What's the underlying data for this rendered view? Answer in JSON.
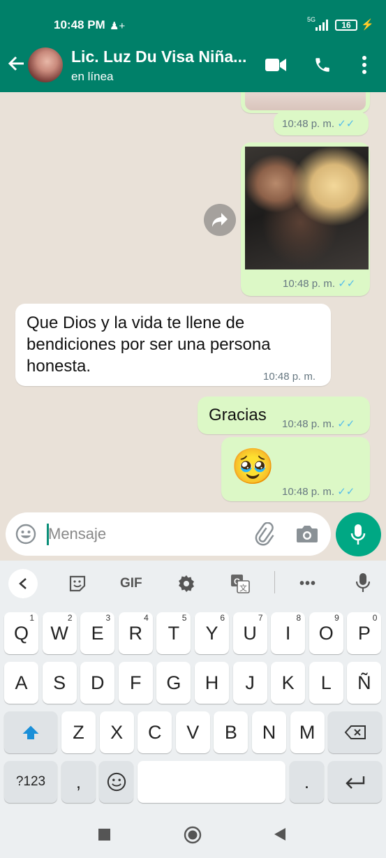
{
  "status_bar": {
    "time": "10:48 PM",
    "network": "5G",
    "battery": "16"
  },
  "header": {
    "contact_name": "Lic. Luz Du Visa Niña...",
    "status": "en línea"
  },
  "messages": [
    {
      "type": "image-partial",
      "direction": "out",
      "time": "10:48 p. m."
    },
    {
      "type": "image",
      "direction": "out",
      "time": "10:48 p. m."
    },
    {
      "type": "text",
      "direction": "in",
      "lines": [
        "Que Dios y la vida te llene de",
        "bendiciones por ser una persona",
        "honesta."
      ],
      "time": "10:48 p. m."
    },
    {
      "type": "text",
      "direction": "out",
      "text": "Gracias",
      "time": "10:48 p. m."
    },
    {
      "type": "emoji",
      "direction": "out",
      "emoji": "🥹",
      "time": "10:48 p. m."
    }
  ],
  "compose": {
    "placeholder": "Mensaje"
  },
  "keyboard": {
    "toolbar": {
      "gif": "GIF"
    },
    "row1": [
      {
        "k": "Q",
        "n": "1"
      },
      {
        "k": "W",
        "n": "2"
      },
      {
        "k": "E",
        "n": "3"
      },
      {
        "k": "R",
        "n": "4"
      },
      {
        "k": "T",
        "n": "5"
      },
      {
        "k": "Y",
        "n": "6"
      },
      {
        "k": "U",
        "n": "7"
      },
      {
        "k": "I",
        "n": "8"
      },
      {
        "k": "O",
        "n": "9"
      },
      {
        "k": "P",
        "n": "0"
      }
    ],
    "row2": [
      "A",
      "S",
      "D",
      "F",
      "G",
      "H",
      "J",
      "K",
      "L",
      "Ñ"
    ],
    "row3": [
      "Z",
      "X",
      "C",
      "V",
      "B",
      "N",
      "M"
    ],
    "symbols": "?123",
    "comma": ",",
    "period": "."
  },
  "colors": {
    "header": "#008069",
    "outgoing_bubble": "#dcf8c6",
    "incoming_bubble": "#ffffff",
    "read_ticks": "#53bdeb",
    "fab": "#00a884"
  },
  "icons": [
    "back-arrow-icon",
    "video-call-icon",
    "phone-icon",
    "more-vert-icon",
    "forward-icon",
    "read-ticks-icon",
    "emoji-icon",
    "attach-icon",
    "camera-icon",
    "mic-icon",
    "sticker-icon",
    "settings-icon",
    "translate-icon",
    "more-horiz-icon",
    "shift-icon",
    "backspace-icon",
    "enter-icon",
    "nav-square-icon",
    "nav-home-icon",
    "nav-back-icon"
  ]
}
